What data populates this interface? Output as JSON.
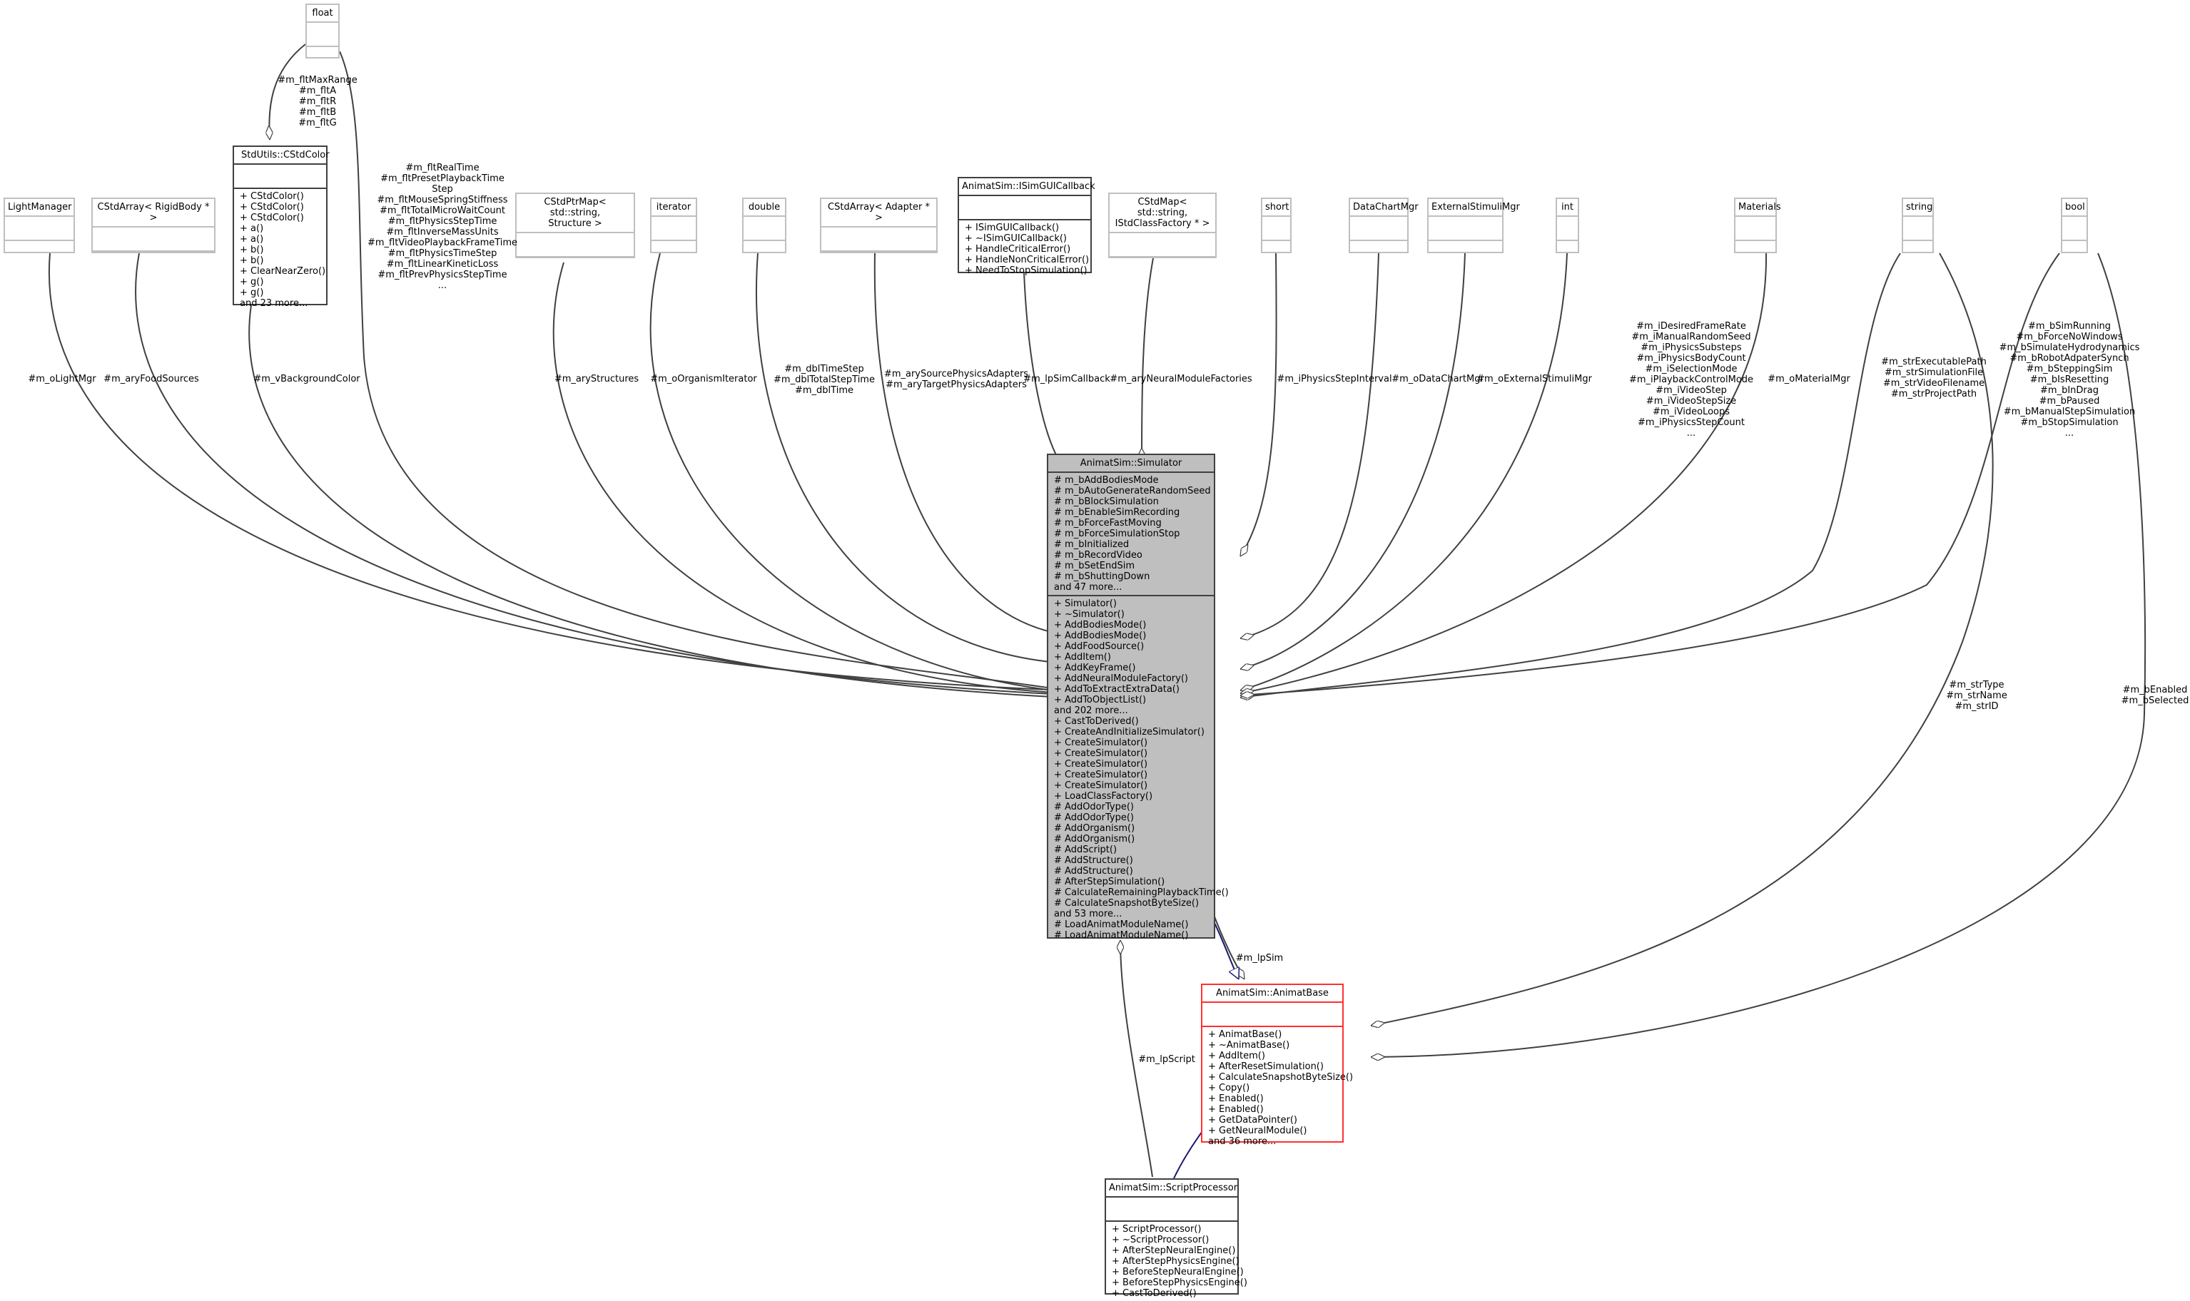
{
  "main_class": {
    "name": "AnimatSim::Simulator",
    "attributes": [
      "# m_bAddBodiesMode",
      "# m_bAutoGenerateRandomSeed",
      "# m_bBlockSimulation",
      "# m_bEnableSimRecording",
      "# m_bForceFastMoving",
      "# m_bForceSimulationStop",
      "# m_bInitialized",
      "# m_bRecordVideo",
      "# m_bSetEndSim",
      "# m_bShuttingDown",
      "and 47 more..."
    ],
    "methods": [
      "+ Simulator()",
      "+ ~Simulator()",
      "+ AddBodiesMode()",
      "+ AddBodiesMode()",
      "+ AddFoodSource()",
      "+ AddItem()",
      "+ AddKeyFrame()",
      "+ AddNeuralModuleFactory()",
      "+ AddToExtractExtraData()",
      "+ AddToObjectList()",
      "and 202 more...",
      "+ CastToDerived()",
      "+ CreateAndInitializeSimulator()",
      "+ CreateSimulator()",
      "+ CreateSimulator()",
      "+ CreateSimulator()",
      "+ CreateSimulator()",
      "+ CreateSimulator()",
      "+ LoadClassFactory()",
      "# AddOdorType()",
      "# AddOdorType()",
      "# AddOrganism()",
      "# AddOrganism()",
      "# AddScript()",
      "# AddStructure()",
      "# AddStructure()",
      "# AfterStepSimulation()",
      "# CalculateRemainingPlaybackTime()",
      "# CalculateSnapshotByteSize()",
      "and 53 more...",
      "# LoadAnimatModuleName()",
      "# LoadAnimatModuleName()"
    ]
  },
  "nodes": {
    "float": {
      "name": "float"
    },
    "cstdcolor": {
      "name": "StdUtils::CStdColor",
      "methods": [
        "+ CStdColor()",
        "+ CStdColor()",
        "+ CStdColor()",
        "+ a()",
        "+ a()",
        "+ b()",
        "+ b()",
        "+ ClearNearZero()",
        "+ g()",
        "+ g()",
        "and 23 more..."
      ]
    },
    "lightmanager": {
      "name": "LightManager"
    },
    "cstdarray_rigidbody": {
      "name": "CStdArray< RigidBody * >"
    },
    "cstdptrmap_structure": {
      "name": "CStdPtrMap< std::string,\nStructure >"
    },
    "iterator": {
      "name": "iterator"
    },
    "double": {
      "name": "double"
    },
    "cstdarray_adapter": {
      "name": "CStdArray< Adapter * >"
    },
    "isimguicallback": {
      "name": "AnimatSim::ISimGUICallback",
      "methods": [
        "+ ISimGUICallback()",
        "+ ~ISimGUICallback()",
        "+ HandleCriticalError()",
        "+ HandleNonCriticalError()",
        "+ NeedToStopSimulation()"
      ]
    },
    "cstdmap_factory": {
      "name": "CStdMap< std::string,\nIStdClassFactory * >"
    },
    "short": {
      "name": "short"
    },
    "datachartmgr": {
      "name": "DataChartMgr"
    },
    "externalstimulimgr": {
      "name": "ExternalStimuliMgr"
    },
    "int": {
      "name": "int"
    },
    "materials": {
      "name": "Materials"
    },
    "string": {
      "name": "string"
    },
    "bool": {
      "name": "bool"
    },
    "animatbase": {
      "name": "AnimatSim::AnimatBase",
      "methods": [
        "+ AnimatBase()",
        "+ ~AnimatBase()",
        "+ AddItem()",
        "+ AfterResetSimulation()",
        "+ CalculateSnapshotByteSize()",
        "+ Copy()",
        "+ Enabled()",
        "+ Enabled()",
        "+ GetDataPointer()",
        "+ GetNeuralModule()",
        "and 36 more..."
      ]
    },
    "scriptprocessor": {
      "name": "AnimatSim::ScriptProcessor",
      "methods": [
        "+ ScriptProcessor()",
        "+ ~ScriptProcessor()",
        "+ AfterStepNeuralEngine()",
        "+ AfterStepPhysicsEngine()",
        "+ BeforeStepNeuralEngine()",
        "+ BeforeStepPhysicsEngine()",
        "+ CastToDerived()"
      ]
    }
  },
  "edge_labels": {
    "float_color": [
      "#m_fltMaxRange",
      "#m_fltA",
      "#m_fltR",
      "#m_fltB",
      "#m_fltG"
    ],
    "float_sim": [
      "#m_fltRealTime",
      "#m_fltPresetPlaybackTime",
      "Step",
      "#m_fltMouseSpringStiffness",
      "#m_fltTotalMicroWaitCount",
      "#m_fltPhysicsStepTime",
      "#m_fltInverseMassUnits",
      "#m_fltVideoPlaybackFrameTime",
      "#m_fltPhysicsTimeStep",
      "#m_fltLinearKineticLoss",
      "#m_fltPrevPhysicsStepTime",
      "..."
    ],
    "light": [
      "#m_oLightMgr"
    ],
    "food": [
      "#m_aryFoodSources"
    ],
    "bgcolor": [
      "#m_vBackgroundColor"
    ],
    "structures": [
      "#m_aryStructures"
    ],
    "orgiter": [
      "#m_oOrganismIterator"
    ],
    "double": [
      "#m_dblTimeStep",
      "#m_dblTotalStepTime",
      "#m_dblTime"
    ],
    "adapters": [
      "#m_arySourcePhysicsAdapters",
      "#m_aryTargetPhysicsAdapters"
    ],
    "callback": [
      "#m_lpSimCallback"
    ],
    "factories": [
      "#m_aryNeuralModuleFactories"
    ],
    "short": [
      "#m_iPhysicsStepInterval"
    ],
    "datachart": [
      "#m_oDataChartMgr"
    ],
    "extstim": [
      "#m_oExternalStimuliMgr"
    ],
    "int": [
      "#m_iDesiredFrameRate",
      "#m_iManualRandomSeed",
      "#m_iPhysicsSubsteps",
      "#m_iPhysicsBodyCount",
      "#m_iSelectionMode",
      "#m_iPlaybackControlMode",
      "#m_iVideoStep",
      "#m_iVideoStepSize",
      "#m_iVideoLoops",
      "#m_iPhysicsStepCount",
      "..."
    ],
    "materials": [
      "#m_oMaterialMgr"
    ],
    "string_sim": [
      "#m_strExecutablePath",
      "#m_strSimulationFile",
      "#m_strVideoFilename",
      "#m_strProjectPath"
    ],
    "bool_sim": [
      "#m_bSimRunning",
      "#m_bForceNoWindows",
      "#m_bSimulateHydrodynamics",
      "#m_bRobotAdpaterSynch",
      "#m_bSteppingSim",
      "#m_bIsResetting",
      "#m_bInDrag",
      "#m_bPaused",
      "#m_bManualStepSimulation",
      "#m_bStopSimulation",
      "..."
    ],
    "string_base": [
      "#m_strType",
      "#m_strName",
      "#m_strID"
    ],
    "bool_base": [
      "#m_bEnabled",
      "#m_bSelected"
    ],
    "lpsim": [
      "#m_lpSim"
    ],
    "lpscript": [
      "#m_lpScript"
    ]
  }
}
